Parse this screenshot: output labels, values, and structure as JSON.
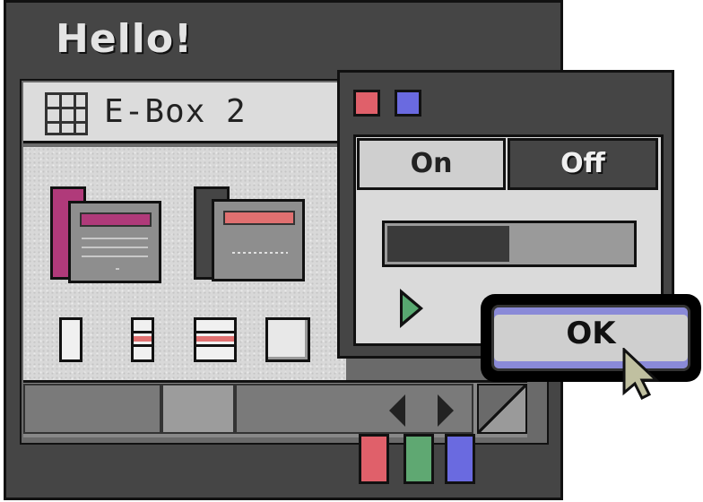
{
  "main_window": {
    "title": "Hello!",
    "ebox": {
      "icon": "grid-icon",
      "title": "E-Box 2"
    }
  },
  "panel": {
    "tabs": [
      {
        "label": "On",
        "selected": false
      },
      {
        "label": "Off",
        "selected": true
      }
    ],
    "progress": 0.5,
    "play_icon": "play-triangle-icon"
  },
  "ok_button": {
    "label": "OK"
  },
  "colors": {
    "red": "#e0606a",
    "green": "#5fa872",
    "blue": "#6a6ae0",
    "folder_accent_pink": "#b03a7a",
    "folder_accent_red": "#e07070"
  }
}
